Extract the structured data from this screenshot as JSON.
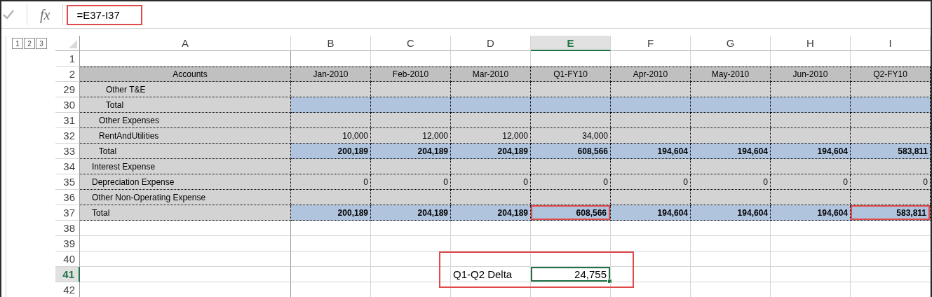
{
  "formula_bar": {
    "function_label": "fx",
    "formula": "=E37-I37",
    "highlighted": true
  },
  "outline_levels": [
    "1",
    "2",
    "3"
  ],
  "columns": [
    {
      "label": "A",
      "selected": false
    },
    {
      "label": "B",
      "selected": false
    },
    {
      "label": "C",
      "selected": false
    },
    {
      "label": "D",
      "selected": false
    },
    {
      "label": "E",
      "selected": true
    },
    {
      "label": "F",
      "selected": false
    },
    {
      "label": "G",
      "selected": false
    },
    {
      "label": "H",
      "selected": false
    },
    {
      "label": "I",
      "selected": false
    }
  ],
  "rows": [
    {
      "number": "1",
      "kind": "blank",
      "selected": false,
      "cells": {}
    },
    {
      "number": "2",
      "kind": "header",
      "selected": false,
      "cells": {
        "A": "Accounts",
        "B": "Jan-2010",
        "C": "Feb-2010",
        "D": "Mar-2010",
        "E": "Q1-FY10",
        "F": "Apr-2010",
        "G": "May-2010",
        "H": "Jun-2010",
        "I": "Q2-FY10"
      }
    },
    {
      "number": "29",
      "kind": "detail",
      "selected": false,
      "cells": {
        "A": "      Other T&E"
      }
    },
    {
      "number": "30",
      "kind": "total",
      "selected": false,
      "cells": {
        "A": "      Total"
      }
    },
    {
      "number": "31",
      "kind": "detail",
      "selected": false,
      "cells": {
        "A": "   Other Expenses"
      }
    },
    {
      "number": "32",
      "kind": "detail",
      "selected": false,
      "cells": {
        "A": "   RentAndUtilities",
        "B": "10,000",
        "C": "12,000",
        "D": "12,000",
        "E": "34,000"
      }
    },
    {
      "number": "33",
      "kind": "total",
      "selected": false,
      "cells": {
        "A": "   Total",
        "B": "200,189",
        "C": "204,189",
        "D": "204,189",
        "E": "608,566",
        "F": "194,604",
        "G": "194,604",
        "H": "194,604",
        "I": "583,811"
      }
    },
    {
      "number": "34",
      "kind": "detail",
      "selected": false,
      "cells": {
        "A": "Interest Expense"
      }
    },
    {
      "number": "35",
      "kind": "detail",
      "selected": false,
      "cells": {
        "A": "Depreciation Expense",
        "B": "0",
        "C": "0",
        "D": "0",
        "E": "0",
        "F": "0",
        "G": "0",
        "H": "0",
        "I": "0"
      }
    },
    {
      "number": "36",
      "kind": "detail",
      "selected": false,
      "cells": {
        "A": "Other Non-Operating Expense"
      }
    },
    {
      "number": "37",
      "kind": "total",
      "selected": false,
      "cells": {
        "A": "Total",
        "B": "200,189",
        "C": "204,189",
        "D": "204,189",
        "E": {
          "text": "608,566",
          "highlighted": true
        },
        "F": "194,604",
        "G": "194,604",
        "H": "194,604",
        "I": {
          "text": "583,811",
          "highlighted": true
        }
      }
    },
    {
      "number": "38",
      "kind": "blank",
      "selected": false,
      "cells": {}
    },
    {
      "number": "39",
      "kind": "blank",
      "selected": false,
      "cells": {}
    },
    {
      "number": "40",
      "kind": "blank",
      "selected": false,
      "cells": {}
    },
    {
      "number": "41",
      "kind": "blank",
      "selected": true,
      "callout": true,
      "cells": {
        "D": {
          "text": "Q1-Q2 Delta",
          "kind": "label"
        },
        "E": {
          "text": "24,755",
          "selected": true
        }
      }
    },
    {
      "number": "42",
      "kind": "blank",
      "selected": false,
      "cells": {}
    }
  ]
}
